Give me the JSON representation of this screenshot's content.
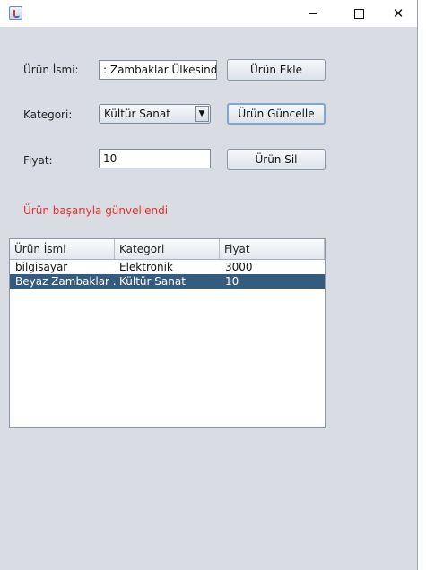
{
  "window": {
    "title": "",
    "icons": {
      "app": "java-cup-icon",
      "minimize": "minimize-icon",
      "maximize": "maximize-icon",
      "close": "close-icon"
    },
    "close_glyph": "✕"
  },
  "form": {
    "name_label": "Ürün İsmi:",
    "name_value": ": Zambaklar Ülkesinde",
    "category_label": "Kategori:",
    "category_value": "Kültür Sanat",
    "price_label": "Fiyat:",
    "price_value": "10",
    "add_button": "Ürün Ekle",
    "update_button": "Ürün Güncelle",
    "delete_button": "Ürün Sil"
  },
  "status": {
    "message": "Ürün başarıyla günvellendi",
    "color": "#e0302a"
  },
  "table": {
    "columns": [
      "Ürün İsmi",
      "Kategori",
      "Fiyat"
    ],
    "rows": [
      [
        "bilgisayar",
        "Elektronik",
        "3000"
      ],
      [
        "Beyaz Zambaklar ...",
        "Kültür Sanat",
        "10"
      ]
    ],
    "selected_row": 1,
    "selection_color": "#335c7e"
  }
}
